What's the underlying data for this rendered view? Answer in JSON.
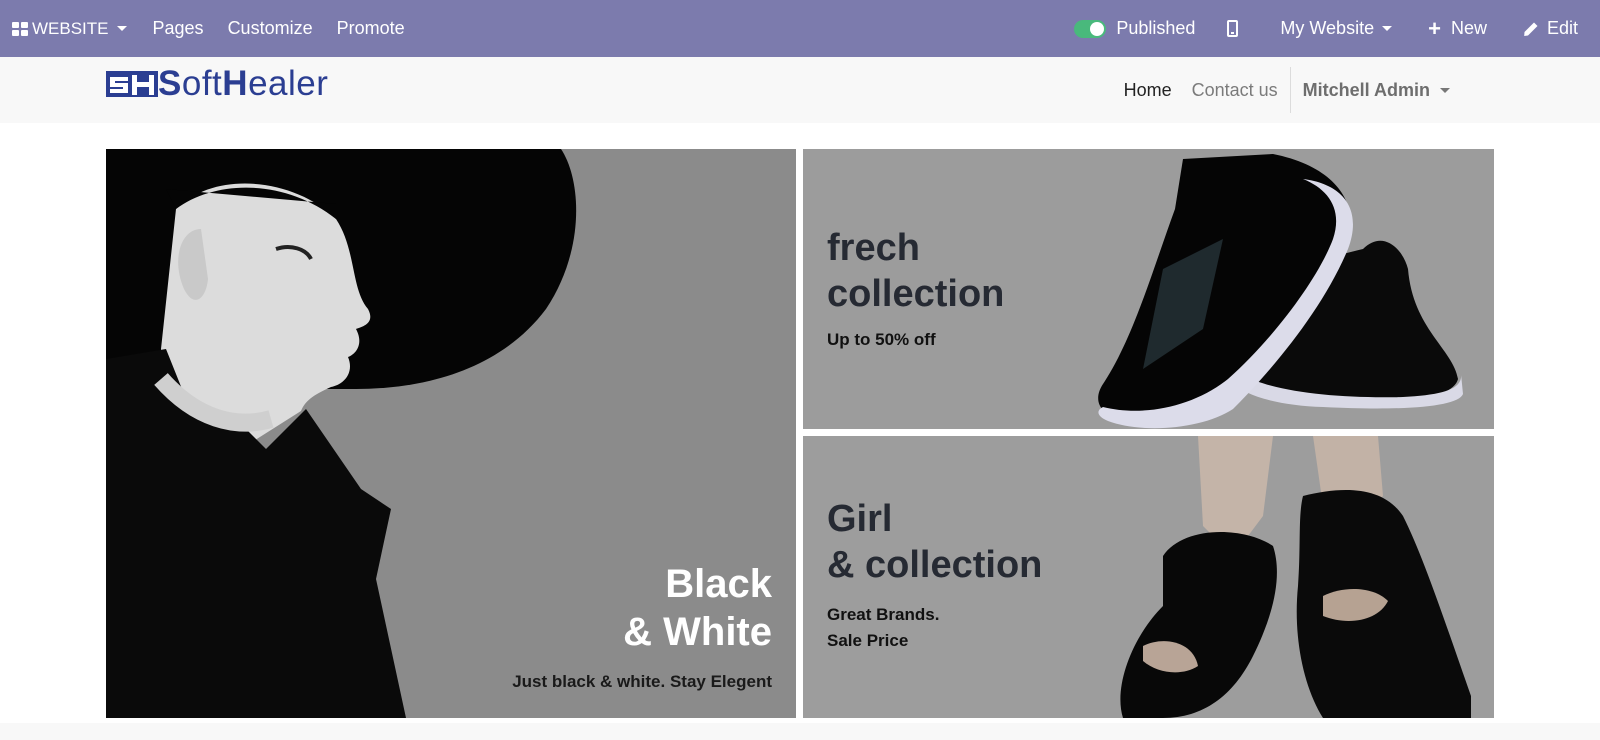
{
  "adminbar": {
    "brand": "WEBSITE",
    "menu": [
      "Pages",
      "Customize",
      "Promote"
    ],
    "published_label": "Published",
    "website_label": "My Website",
    "new_label": "New",
    "edit_label": "Edit",
    "color": "#7c7bad"
  },
  "logo": {
    "text_a": "S",
    "text_b": "oft",
    "text_c": "H",
    "text_d": "ealer",
    "color": "#2b3e92"
  },
  "nav": {
    "items": [
      "Home",
      "Contact us"
    ],
    "user": "Mitchell Admin"
  },
  "banners": {
    "left": {
      "title_line1": "Black",
      "title_line2": "& White",
      "subtitle": "Just black & white. Stay Elegent"
    },
    "top_right": {
      "title_line1": "frech",
      "title_line2": "collection",
      "subtitle": "Up to 50% off"
    },
    "bottom_right": {
      "title_line1": "Girl",
      "title_line2": "& collection",
      "subtitle_line1": "Great Brands.",
      "subtitle_line2": "Sale Price"
    }
  },
  "icons": [
    "apps-grid-icon",
    "toggle-icon",
    "mobile-preview-icon",
    "plus-icon",
    "pencil-icon",
    "caret-down-icon"
  ]
}
